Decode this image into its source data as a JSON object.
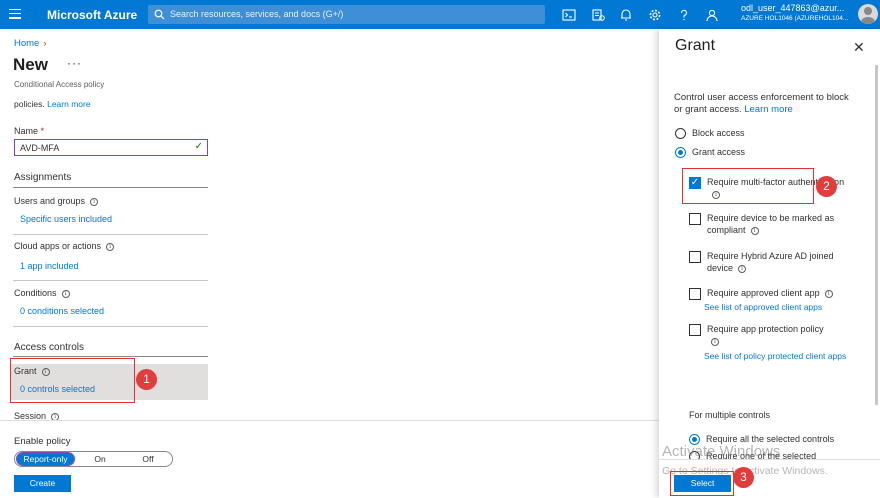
{
  "topbar": {
    "brand": "Microsoft Azure",
    "search_placeholder": "Search resources, services, and docs (G+/)",
    "icons": [
      "cloud-shell-icon",
      "directory-filter-icon",
      "notifications-icon",
      "settings-icon",
      "help-icon",
      "feedback-icon"
    ],
    "user_email": "odl_user_447863@azur...",
    "user_tenant": "AZURE HOL1046 (AZUREHOL104..."
  },
  "left": {
    "breadcrumb": "Home",
    "title": "New",
    "more": "···",
    "subtitle": "Conditional Access policy",
    "policies_text": "policies.",
    "learn_more": "Learn more",
    "name_label": "Name",
    "name_required": "*",
    "name_value": "AVD-MFA",
    "assignments_heading": "Assignments",
    "users_label": "Users and groups",
    "users_value": "Specific users included",
    "cloud_apps_label": "Cloud apps or actions",
    "cloud_apps_value": "1 app included",
    "conditions_label": "Conditions",
    "conditions_value": "0 conditions selected",
    "access_controls_heading": "Access controls",
    "grant_label": "Grant",
    "grant_value": "0 controls selected",
    "session_label": "Session",
    "enable_policy_label": "Enable policy",
    "toggle_options": [
      "Report-only",
      "On",
      "Off"
    ],
    "toggle_selected": "Report-only",
    "create_button": "Create"
  },
  "grant_blade": {
    "title": "Grant",
    "description": "Control user access enforcement to block or grant access.",
    "learn_more": "Learn more",
    "block_access": "Block access",
    "grant_access": "Grant access",
    "grant_access_selected": true,
    "require_mfa": "Require multi-factor authentication",
    "require_mfa_checked": true,
    "require_compliant": "Require device to be marked as compliant",
    "require_hybrid": "Require Hybrid Azure AD joined device",
    "require_approved_app": "Require approved client app",
    "approved_apps_link": "See list of approved client apps",
    "require_app_protection": "Require app protection policy",
    "protected_apps_link": "See list of policy protected client apps",
    "multiple_controls_label": "For multiple controls",
    "require_all": "Require all the selected controls",
    "require_one": "Require one of the selected",
    "select_button": "Select"
  },
  "annotations": [
    "1",
    "2",
    "3"
  ],
  "watermark": {
    "line1": "Activate Windows",
    "line2": "Go to Settings to activate Windows."
  },
  "colors": {
    "azure_blue": "#0078d4",
    "annotation_red": "#e23d3d"
  }
}
